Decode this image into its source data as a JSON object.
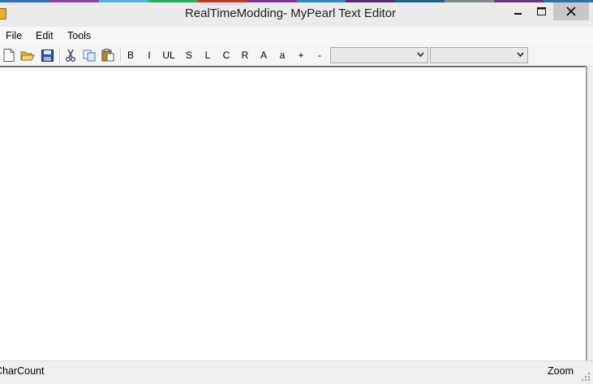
{
  "window": {
    "title": "RealTimeModding- MyPearl Text Editor",
    "desktop_strip_colors": [
      "#2e6fbf",
      "#8e44ad",
      "#4fb3d9",
      "#27ae60",
      "#c0392b",
      "#7d3c98",
      "#2e86c1",
      "#5b2c6f",
      "#1f618d",
      "#7f8c8d",
      "#6c3483",
      "#2874a6"
    ]
  },
  "menu": {
    "file": "File",
    "edit": "Edit",
    "tools": "Tools"
  },
  "toolbar": {
    "icons": {
      "new": "new-document-icon",
      "open": "open-folder-icon",
      "save": "save-disk-icon",
      "cut": "cut-scissors-icon",
      "copy": "copy-icon",
      "paste": "paste-clipboard-icon"
    },
    "bold": "B",
    "italic": "I",
    "underline": "UL",
    "strike": "S",
    "left": "L",
    "center": "C",
    "right": "R",
    "upper": "A",
    "lower": "a",
    "grow": "+",
    "shrink": "-",
    "font_select_value": "",
    "size_select_value": ""
  },
  "editor": {
    "content": ""
  },
  "status": {
    "char_count": "CharCount",
    "zoom": "Zoom"
  }
}
